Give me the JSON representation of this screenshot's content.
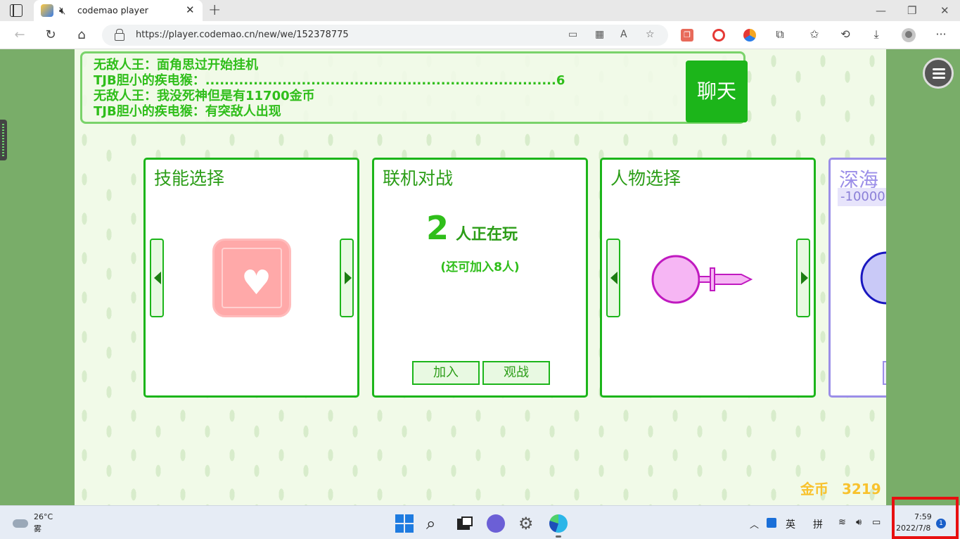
{
  "browser": {
    "tab_title": "codemao player",
    "url": "https://player.codemao.cn/new/we/152378775"
  },
  "chat": {
    "lines": [
      "无敌人王：面角思过开始挂机",
      "TJB胆小的疾电猴：.........................................................................6",
      "无敌人王：我没死神但是有11700金币",
      "TJB胆小的疾电猴：有突敌人出现"
    ],
    "button_label": "聊天"
  },
  "cards": {
    "skill": {
      "title": "技能选择"
    },
    "online": {
      "title": "联机对战",
      "count": "2",
      "count_label": "人正在玩",
      "sub_label": "(还可加入8人)",
      "join_label": "加入",
      "watch_label": "观战"
    },
    "character": {
      "title": "人物选择"
    },
    "map": {
      "title": "深海",
      "price": "-10000"
    }
  },
  "gold": {
    "label": "金币",
    "value": "3219"
  },
  "taskbar": {
    "temperature": "26°C",
    "weather": "雾",
    "ime_lang": "英",
    "ime_mode": "拼",
    "time": "7:59",
    "date": "2022/7/8",
    "notification_count": "1"
  },
  "colors": {
    "accent_green": "#1cb51a",
    "chat_text": "#2fbe1a",
    "gold": "#f8c22d",
    "map_card_border": "#9b8ee8",
    "highlight_red": "#e81010"
  }
}
